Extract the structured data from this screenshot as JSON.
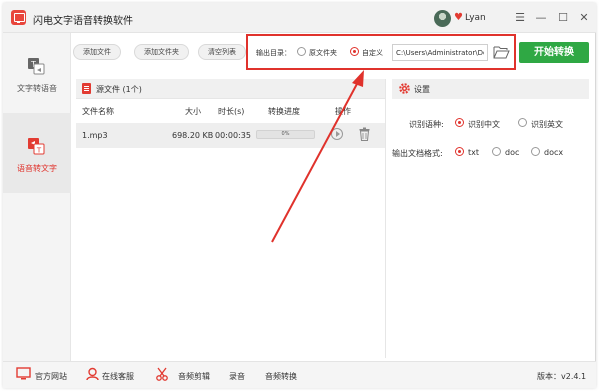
{
  "app": {
    "title": "闪电文字语音转换软件",
    "username": "Lyan"
  },
  "window_controls": {
    "menu": "☰",
    "minimize": "—",
    "maximize": "☐",
    "close": "✕"
  },
  "sidebar": {
    "items": [
      {
        "label": "文字转语音",
        "active": false
      },
      {
        "label": "语音转文字",
        "active": true
      }
    ]
  },
  "toolbar": {
    "add_file": "添加文件",
    "add_folder": "添加文件夹",
    "clear_list": "清空列表"
  },
  "output": {
    "label": "输出目录：",
    "option_source": "原文件夹",
    "option_custom": "自定义",
    "selected": "自定义",
    "path": "C:\\Users\\Administrator\\De",
    "start_button": "开始转换"
  },
  "file_panel": {
    "title": "源文件 (1个)",
    "columns": [
      "文件名称",
      "大小",
      "时长(s)",
      "转换进度",
      "操作"
    ],
    "rows": [
      {
        "name": "1.mp3",
        "size": "698.20 KB",
        "duration": "00:00:35",
        "progress_text": "0%",
        "progress": 0
      }
    ]
  },
  "settings": {
    "title": "设置",
    "language_label": "识别语种:",
    "language_options": [
      "识别中文",
      "识别英文"
    ],
    "language_selected": "识别中文",
    "format_label": "输出文档格式:",
    "format_options": [
      "txt",
      "doc",
      "docx"
    ],
    "format_selected": "txt"
  },
  "bottom_bar": {
    "website": "官方网站",
    "support": "在线客服",
    "audio_edit": "音频剪辑",
    "record": "录音",
    "audio_convert": "音频转换",
    "version": "版本：v2.4.1"
  },
  "colors": {
    "accent_red": "#e0322c",
    "start_green": "#2fa844"
  }
}
